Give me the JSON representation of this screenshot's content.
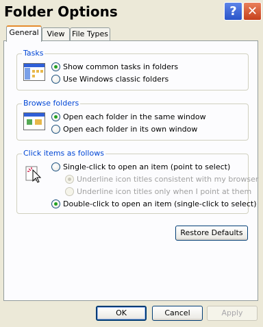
{
  "window": {
    "title": "Folder Options"
  },
  "titlebar": {
    "help_glyph": "?",
    "close_glyph": "✕"
  },
  "tabs": [
    {
      "label": "General",
      "active": true
    },
    {
      "label": "View",
      "active": false
    },
    {
      "label": "File Types",
      "active": false
    }
  ],
  "tasks": {
    "legend": "Tasks",
    "icon": "folder-tasks-icon",
    "options": [
      {
        "label": "Show common tasks in folders",
        "checked": true
      },
      {
        "label": "Use Windows classic folders",
        "checked": false
      }
    ]
  },
  "browse": {
    "legend": "Browse folders",
    "icon": "browse-folders-icon",
    "options": [
      {
        "label": "Open each folder in the same window",
        "checked": true
      },
      {
        "label": "Open each folder in its own window",
        "checked": false
      }
    ]
  },
  "click": {
    "legend": "Click items as follows",
    "icon": "pointer-click-icon",
    "options": [
      {
        "label": "Single-click to open an item (point to select)",
        "checked": false
      },
      {
        "label": "Underline icon titles consistent with my browser",
        "checked": true,
        "disabled": true
      },
      {
        "label": "Underline icon titles only when I point at them",
        "checked": false,
        "disabled": true
      },
      {
        "label": "Double-click to open an item (single-click to select)",
        "checked": true
      }
    ]
  },
  "buttons": {
    "restore": "Restore Defaults",
    "ok": "OK",
    "cancel": "Cancel",
    "apply": "Apply"
  },
  "colors": {
    "legend_text": "#0046d5",
    "dialog_bg": "#ece9d8",
    "radio_check": "#21a121",
    "active_tab_accent": "#e68b2c"
  }
}
